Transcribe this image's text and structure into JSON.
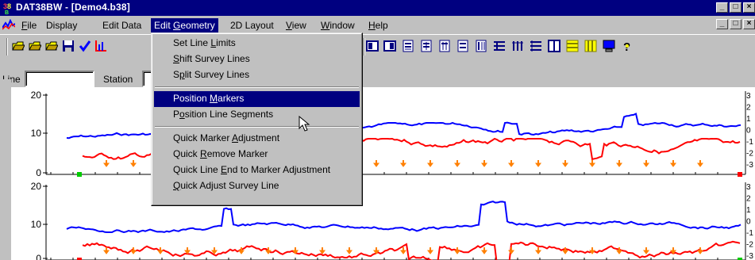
{
  "titlebar": {
    "title": "DAT38BW - [Demo4.b38]",
    "icon": "dat38-app-icon",
    "min": "_",
    "max": "ô",
    "close": "×"
  },
  "menubar": {
    "items": [
      {
        "label": "File",
        "ul": "F"
      },
      {
        "label": "Display",
        "ul": ""
      },
      {
        "label": "Edit Data",
        "ul": ""
      },
      {
        "label": "Edit Geometry",
        "ul": "G"
      },
      {
        "label": "2D Layout",
        "ul": ""
      },
      {
        "label": "View",
        "ul": "V"
      },
      {
        "label": "Window",
        "ul": "W"
      },
      {
        "label": "Help",
        "ul": "H"
      }
    ]
  },
  "dropdown": {
    "items": [
      "Set Line Limits",
      "Shift Survey Lines",
      "Split Survey Lines",
      "Position Markers",
      "Position Line Segments",
      "Quick Marker Adjustment",
      "Quick Remove Marker",
      "Quick Line End to Marker Adjustment",
      "Quick Adjust Survey Line"
    ],
    "highlighted": "Position Markers"
  },
  "toolbar": {
    "line_label": "Line",
    "line_value": "",
    "station_label": "Station",
    "station_value": "",
    "icons": [
      "open-folder-icon",
      "open-folder-2-icon",
      "open-folder-3-icon",
      "save-icon",
      "check-icon",
      "chart-icon",
      "panel-left-icon",
      "panel-right-icon",
      "align-icon-1",
      "align-icon-2",
      "align-icon-3",
      "align-icon-4",
      "align-icon-5",
      "list-icon",
      "bars-icon",
      "lines-icon",
      "window-icon",
      "rows-icon",
      "columns-icon",
      "monitor-icon",
      "help-icon"
    ]
  },
  "chart_data": [
    {
      "type": "line",
      "left_axis_ticks": [
        "20",
        "10",
        "0"
      ],
      "right_axis_ticks": [
        "3",
        "2",
        "1",
        "0",
        "-1",
        "-2",
        "-3"
      ],
      "series": [
        {
          "color": "#0000ff"
        },
        {
          "color": "#ff0000"
        }
      ],
      "markers": "orange arrows"
    },
    {
      "type": "line",
      "left_axis_ticks": [
        "20",
        "10",
        "0"
      ],
      "right_axis_ticks": [
        "3",
        "2",
        "1",
        "0",
        "-1",
        "-2",
        "-3"
      ],
      "series": [
        {
          "color": "#0000ff"
        },
        {
          "color": "#ff0000"
        }
      ],
      "markers": "orange arrows"
    }
  ],
  "colors": {
    "titlebar": "#000080",
    "menu_highlight": "#000080",
    "blue_series": "#0000ff",
    "red_series": "#ff0000",
    "marker": "#ff8000",
    "endpoint_green": "#00cc00",
    "endpoint_red": "#ff0000"
  }
}
